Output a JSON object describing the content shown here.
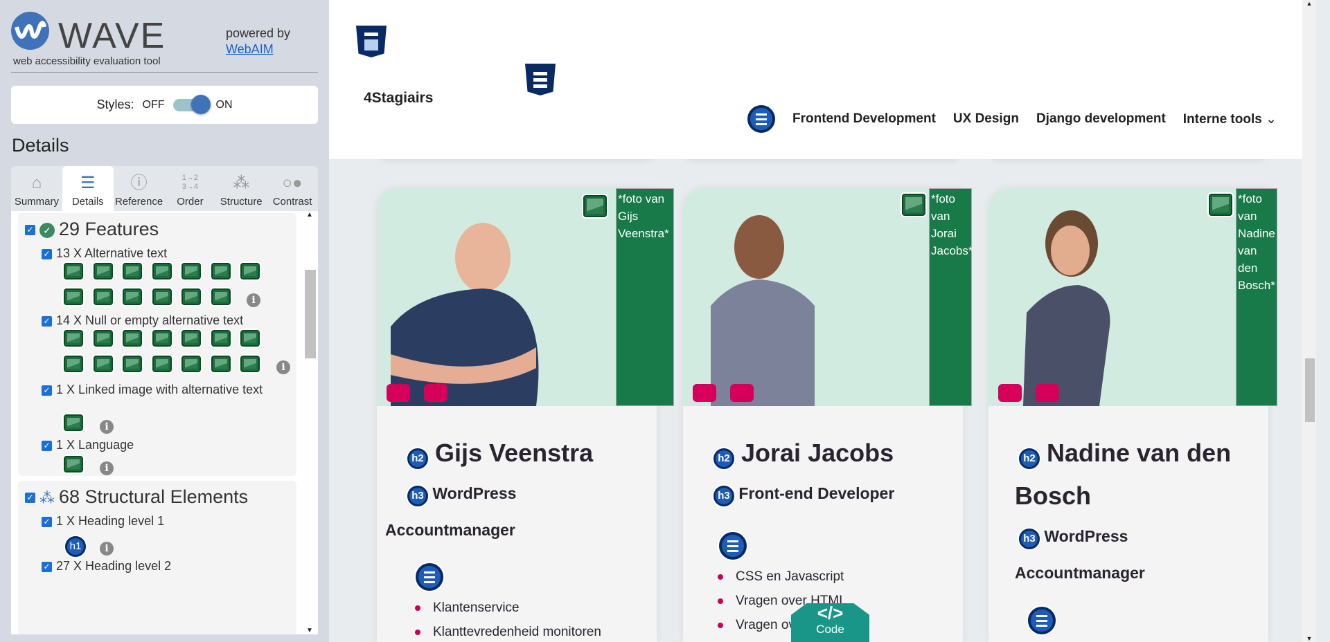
{
  "wave": {
    "title": "WAVE",
    "tagline": "web accessibility evaluation tool",
    "powered_by": "powered by",
    "webaim": "WebAIM",
    "styles_label": "Styles:",
    "off": "OFF",
    "on": "ON",
    "styles_on": true,
    "details_heading": "Details",
    "tabs": [
      {
        "label": "Summary",
        "icon": "home-icon"
      },
      {
        "label": "Details",
        "icon": "list-icon",
        "active": true
      },
      {
        "label": "Reference",
        "icon": "info-icon"
      },
      {
        "label": "Order",
        "icon": "order-icon"
      },
      {
        "label": "Structure",
        "icon": "structure-icon"
      },
      {
        "label": "Contrast",
        "icon": "contrast-icon"
      }
    ],
    "features": {
      "title": "29 Features",
      "items": [
        "13 X Alternative text",
        "14 X Null or empty alternative text",
        "1 X Linked image with alternative text",
        "1 X Language"
      ]
    },
    "structure": {
      "title": "68 Structural Elements",
      "items": [
        "1 X Heading level 1",
        "27 X Heading level 2"
      ],
      "h1": "h1"
    }
  },
  "site": {
    "brand": "4Stagiairs",
    "nav": [
      "Frontend Development",
      "UX Design",
      "Django development",
      "Interne tools"
    ],
    "cards": [
      {
        "alt": "*foto van Gijs Veenstra*",
        "name": "Gijs Veenstra",
        "h3": "WordPress",
        "role": "Accountmanager",
        "list": [
          "Klantenservice",
          "Klanttevredenheid monitoren"
        ]
      },
      {
        "alt": "*foto van Jorai Jacobs*",
        "name": "Jorai Jacobs",
        "h3": "Front-end Developer",
        "role": "",
        "list": [
          "CSS en Javascript",
          "Vragen over HTML",
          "Vragen over"
        ]
      },
      {
        "alt": "*foto van Nadine van den Bosch*",
        "name_line1": "Nadine van den",
        "name_line2": "Bosch",
        "h3": "WordPress",
        "role": "Accountmanager",
        "list": []
      }
    ],
    "h2": "h2",
    "h3_badge": "h3",
    "code_label": "Code",
    "code_glyph": "</>"
  },
  "colors": {
    "wave_blue": "#3f72b9",
    "alt_green": "#177a48",
    "accent_pink": "#cc0055",
    "code_teal": "#1a9688"
  }
}
